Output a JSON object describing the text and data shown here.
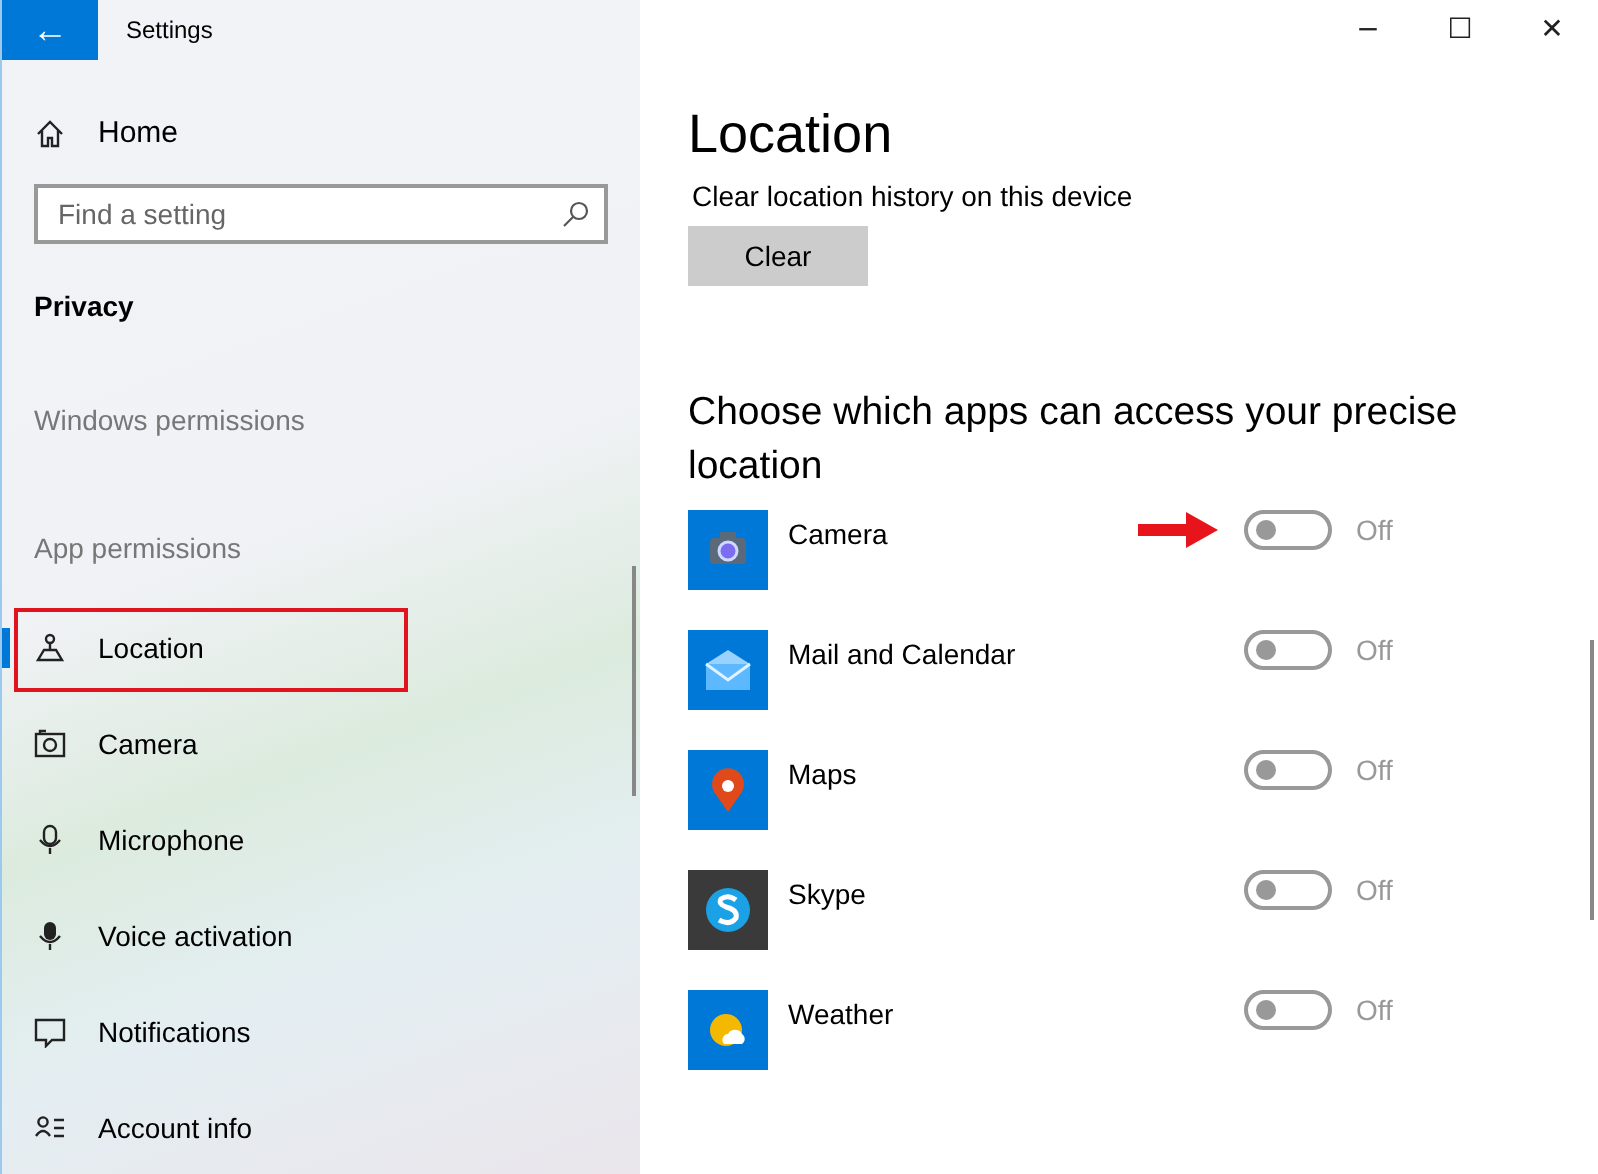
{
  "window": {
    "title": "Settings",
    "back_button": "←",
    "controls": [
      "−",
      "☐",
      "✕"
    ]
  },
  "sidebar": {
    "home": {
      "label": "Home",
      "kind": "home"
    },
    "search": {
      "placeholder": "Find a setting"
    },
    "section": "Privacy",
    "groups": [
      "Windows permissions",
      "App permissions"
    ],
    "items": [
      {
        "label": "Location",
        "kind": "location",
        "selected": true,
        "highlighted": true
      },
      {
        "label": "Camera",
        "kind": "camera",
        "selected": false,
        "highlighted": false
      },
      {
        "label": "Microphone",
        "kind": "microphone",
        "selected": false,
        "highlighted": false
      },
      {
        "label": "Voice activation",
        "kind": "voice",
        "selected": false,
        "highlighted": false
      },
      {
        "label": "Notifications",
        "kind": "notifications",
        "selected": false,
        "highlighted": false
      },
      {
        "label": "Account info",
        "kind": "account",
        "selected": false,
        "highlighted": false
      }
    ]
  },
  "main": {
    "title": "Location",
    "clear_label": "Clear location history on this device",
    "clear_button": "Clear",
    "apps_heading": "Choose which apps can access your precise location",
    "apps": [
      {
        "name": "Camera",
        "kind": "camera",
        "on": false,
        "state": "Off",
        "pointed": true
      },
      {
        "name": "Mail and Calendar",
        "kind": "mail",
        "on": false,
        "state": "Off",
        "pointed": false
      },
      {
        "name": "Maps",
        "kind": "maps",
        "on": false,
        "state": "Off",
        "pointed": false
      },
      {
        "name": "Skype",
        "kind": "skype",
        "on": false,
        "state": "Off",
        "pointed": false
      },
      {
        "name": "Weather",
        "kind": "weather",
        "on": false,
        "state": "Off",
        "pointed": false
      }
    ]
  }
}
